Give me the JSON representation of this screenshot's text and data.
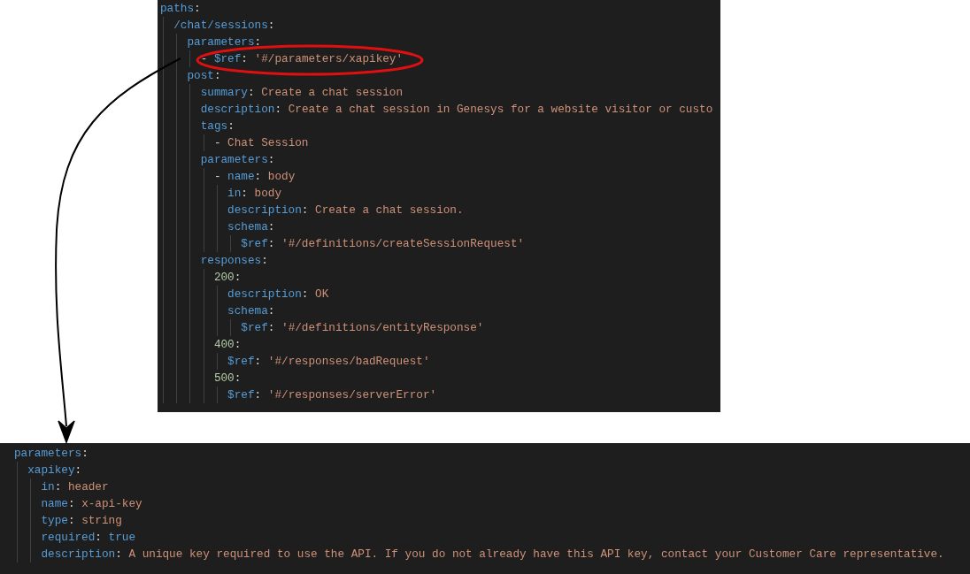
{
  "top_editor": {
    "nodes": [
      {
        "key": "paths:",
        "children": [
          {
            "key": "/chat/sessions:",
            "children": [
              {
                "key": "parameters:",
                "children": [
                  {
                    "bullet": "-",
                    "key": "$ref:",
                    "value": "'#/parameters/xapikey'",
                    "kind": "string"
                  }
                ]
              },
              {
                "key": "post:",
                "children": [
                  {
                    "key": "summary:",
                    "value": "Create a chat session",
                    "kind": "string"
                  },
                  {
                    "key": "description:",
                    "value": "Create a chat session in Genesys for a website visitor or custo",
                    "kind": "string"
                  },
                  {
                    "key": "tags:",
                    "children": [
                      {
                        "bullet": "-",
                        "value": "Chat Session",
                        "kind": "string"
                      }
                    ]
                  },
                  {
                    "key": "parameters:",
                    "children": [
                      {
                        "bullet": "-",
                        "key": "name:",
                        "value": "body",
                        "kind": "string",
                        "children": [
                          {
                            "key": "in:",
                            "value": "body",
                            "kind": "string"
                          },
                          {
                            "key": "description:",
                            "value": "Create a chat session.",
                            "kind": "string"
                          },
                          {
                            "key": "schema:",
                            "children": [
                              {
                                "key": "$ref:",
                                "value": "'#/definitions/createSessionRequest'",
                                "kind": "string"
                              }
                            ]
                          }
                        ]
                      }
                    ]
                  },
                  {
                    "key": "responses:",
                    "children": [
                      {
                        "key": "200:",
                        "kind": "number",
                        "children": [
                          {
                            "key": "description:",
                            "value": "OK",
                            "kind": "string"
                          },
                          {
                            "key": "schema:",
                            "children": [
                              {
                                "key": "$ref:",
                                "value": "'#/definitions/entityResponse'",
                                "kind": "string"
                              }
                            ]
                          }
                        ]
                      },
                      {
                        "key": "400:",
                        "kind": "number",
                        "children": [
                          {
                            "key": "$ref:",
                            "value": "'#/responses/badRequest'",
                            "kind": "string"
                          }
                        ]
                      },
                      {
                        "key": "500:",
                        "kind": "number",
                        "children": [
                          {
                            "key": "$ref:",
                            "value": "'#/responses/serverError'",
                            "kind": "string"
                          }
                        ]
                      }
                    ]
                  }
                ]
              }
            ]
          }
        ]
      }
    ]
  },
  "bottom_editor": {
    "nodes": [
      {
        "key": "parameters:",
        "children": [
          {
            "key": "xapikey:",
            "children": [
              {
                "key": "in:",
                "value": "header",
                "kind": "string"
              },
              {
                "key": "name:",
                "value": "x-api-key",
                "kind": "string"
              },
              {
                "key": "type:",
                "value": "string",
                "kind": "string"
              },
              {
                "key": "required:",
                "value": "true",
                "kind": "bool"
              },
              {
                "key": "description:",
                "value": "A unique key required to use the API. If you do not already have this API key, contact your Customer Care representative.",
                "kind": "string"
              }
            ]
          }
        ]
      }
    ]
  }
}
